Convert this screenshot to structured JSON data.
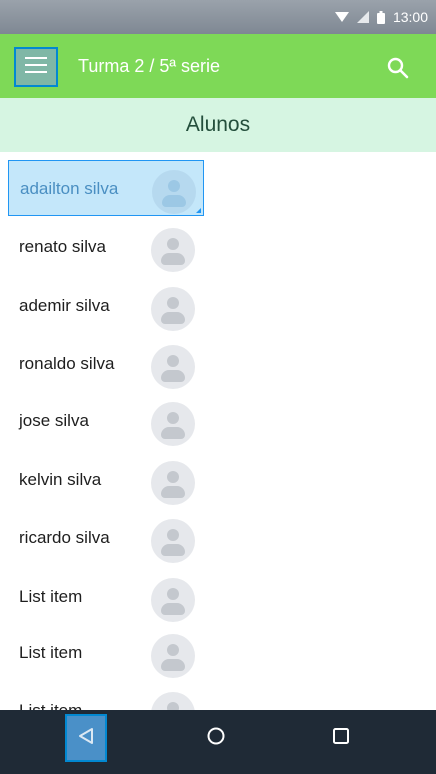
{
  "status_bar": {
    "time": "13:00"
  },
  "app_bar": {
    "title": "Turma 2 / 5ª serie",
    "menu_icon": "hamburger-menu-icon",
    "search_icon": "search-icon"
  },
  "section": {
    "title": "Alunos"
  },
  "students": [
    {
      "name": "adailton silva",
      "selected": true
    },
    {
      "name": "renato silva"
    },
    {
      "name": "ademir silva"
    },
    {
      "name": "ronaldo silva"
    },
    {
      "name": "jose silva"
    },
    {
      "name": "kelvin silva"
    },
    {
      "name": "ricardo silva"
    },
    {
      "name": "List item"
    },
    {
      "name": "List item"
    },
    {
      "name": "List item"
    }
  ],
  "nav_bar": {
    "back_icon": "back-triangle-icon",
    "home_icon": "home-circle-icon",
    "recents_icon": "recents-square-icon"
  },
  "colors": {
    "app_bar": "#7ed957",
    "section_header": "#d6f5e2",
    "selection": "#c4e7fa",
    "nav_bar": "#1f2a36"
  }
}
